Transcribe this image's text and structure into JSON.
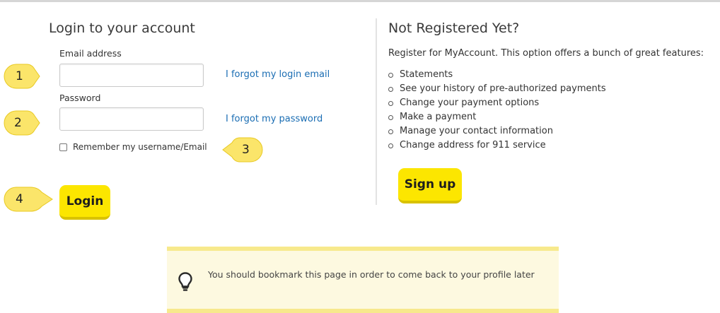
{
  "login": {
    "title": "Login to your account",
    "email_label": "Email address",
    "email_value": "",
    "email_placeholder": "",
    "forgot_email_link": "I forgot my login email",
    "password_label": "Password",
    "password_value": "",
    "password_placeholder": "",
    "forgot_password_link": "I forgot my password",
    "remember_label": "Remember my username/Email",
    "remember_checked": false,
    "login_button": "Login"
  },
  "register": {
    "title": "Not Registered Yet?",
    "intro": "Register for MyAccount. This option offers a bunch of great features:",
    "features": [
      "Statements",
      "See your history of pre-authorized payments",
      "Change your payment options",
      "Make a payment",
      "Manage your contact information",
      "Change address for 911 service"
    ],
    "signup_button": "Sign up"
  },
  "callouts": [
    "1",
    "2",
    "3",
    "4"
  ],
  "tip": {
    "icon": "lightbulb-icon",
    "text": "You should bookmark this page in order to come back to your profile later"
  },
  "colors": {
    "accent_yellow": "#fce600",
    "link_blue": "#1a6db3",
    "tip_background": "#fdf9e0",
    "tip_border": "#f7e98c",
    "callout_yellow": "#fbe56a"
  }
}
